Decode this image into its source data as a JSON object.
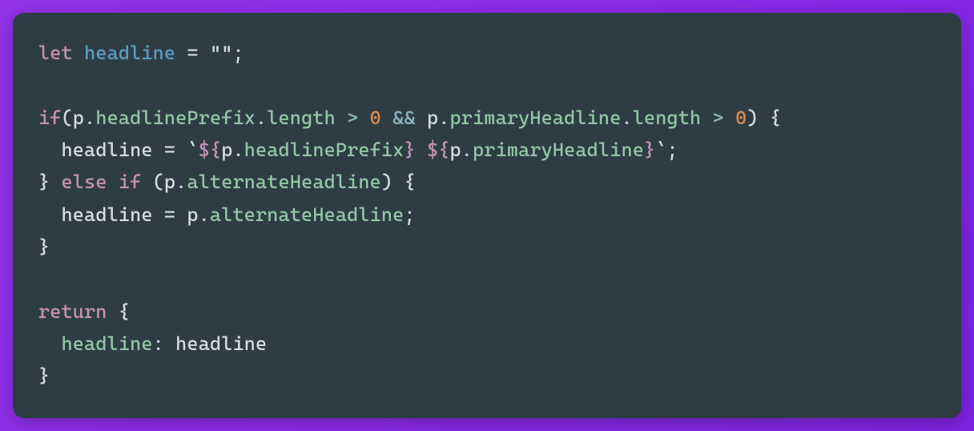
{
  "code": {
    "line1": {
      "kw": "let",
      "var": "headline",
      "eq": " = ",
      "str": "\"\"",
      "semi": ";"
    },
    "line2": "",
    "line3": {
      "kw": "if",
      "open": "(p.",
      "prop1": "headlinePrefix",
      "dot1": ".",
      "prop1b": "length",
      "op1": " > ",
      "num1": "0",
      "and": " && ",
      "p2": "p.",
      "prop2": "primaryHeadline",
      "dot2": ".",
      "prop2b": "length",
      "op2": " > ",
      "num2": "0",
      "close": ") {"
    },
    "line4": {
      "indent": "  ",
      "var": "headline",
      "eq": " = ",
      "tick1": "`",
      "interp1o": "${",
      "p1": "p.",
      "prop1": "headlinePrefix",
      "interp1c": "}",
      "space": " ",
      "interp2o": "${",
      "p2": "p.",
      "prop2": "primaryHeadline",
      "interp2c": "}",
      "tick2": "`",
      "semi": ";"
    },
    "line5": {
      "close": "} ",
      "kw1": "else",
      "sp": " ",
      "kw2": "if",
      "open": " (p.",
      "prop": "alternateHeadline",
      "close2": ") {"
    },
    "line6": {
      "indent": "  ",
      "var": "headline",
      "eq": " = p.",
      "prop": "alternateHeadline",
      "semi": ";"
    },
    "line7": "}",
    "line8": "",
    "line9": {
      "kw": "return",
      "open": " {"
    },
    "line10": {
      "indent": "  ",
      "key": "headline",
      "colon": ": ",
      "val": "headline"
    },
    "line11": "}"
  }
}
